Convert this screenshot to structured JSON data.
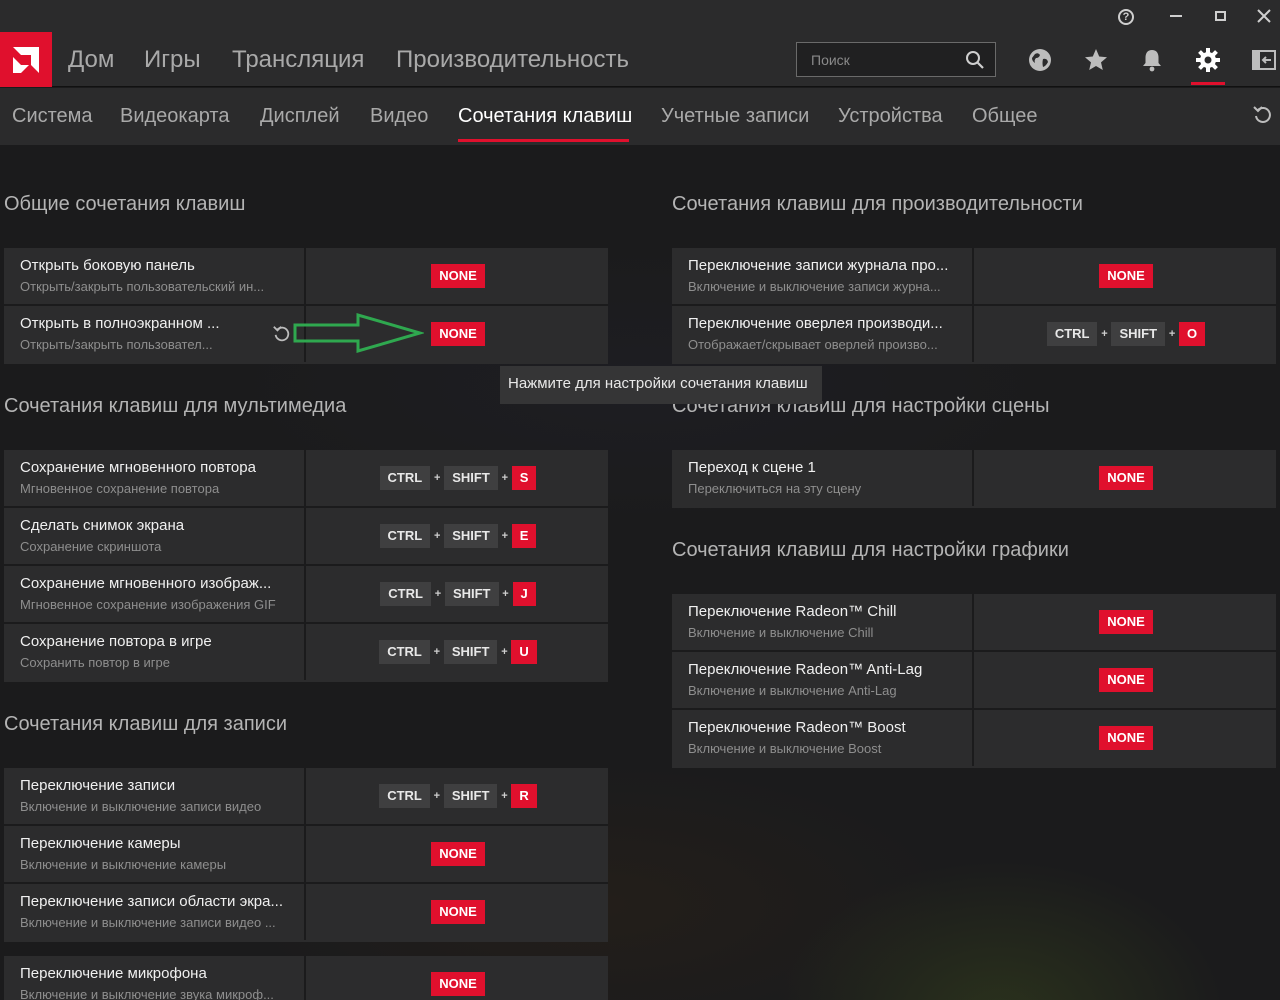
{
  "window": {
    "help": "?"
  },
  "nav": {
    "items": [
      "Дом",
      "Игры",
      "Трансляция",
      "Производительность"
    ],
    "search_placeholder": "Поиск"
  },
  "subnav": {
    "items": [
      "Система",
      "Видеокарта",
      "Дисплей",
      "Видео",
      "Сочетания клавиш",
      "Учетные записи",
      "Устройства",
      "Общее"
    ],
    "active": "Сочетания клавиш"
  },
  "tooltip": "Нажмите для настройки сочетания клавиш",
  "sections": {
    "general": {
      "title": "Общие сочетания клавиш",
      "rows": [
        {
          "name": "Открыть боковую панель",
          "desc": "Открыть/закрыть пользовательский ин...",
          "keys": [
            "NONE"
          ]
        },
        {
          "name": "Открыть в полноэкранном ...",
          "desc": "Открыть/закрыть пользовател...",
          "keys": [
            "NONE"
          ]
        }
      ]
    },
    "media": {
      "title": "Сочетания клавиш для мультимедиа",
      "rows": [
        {
          "name": "Сохранение мгновенного повтора",
          "desc": "Мгновенное сохранение повтора",
          "keys": [
            "CTRL",
            "SHIFT",
            "S"
          ]
        },
        {
          "name": "Сделать снимок экрана",
          "desc": "Сохранение скриншота",
          "keys": [
            "CTRL",
            "SHIFT",
            "E"
          ]
        },
        {
          "name": "Сохранение мгновенного изображ...",
          "desc": "Мгновенное сохранение изображения GIF",
          "keys": [
            "CTRL",
            "SHIFT",
            "J"
          ]
        },
        {
          "name": "Сохранение повтора в игре",
          "desc": "Сохранить повтор в игре",
          "keys": [
            "CTRL",
            "SHIFT",
            "U"
          ]
        }
      ]
    },
    "record": {
      "title": "Сочетания клавиш для записи",
      "rows": [
        {
          "name": "Переключение записи",
          "desc": "Включение и выключение записи видео",
          "keys": [
            "CTRL",
            "SHIFT",
            "R"
          ]
        },
        {
          "name": "Переключение камеры",
          "desc": "Включение и выключение камеры",
          "keys": [
            "NONE"
          ]
        },
        {
          "name": "Переключение записи области экра...",
          "desc": "Включение и выключение записи видео ...",
          "keys": [
            "NONE"
          ]
        }
      ]
    },
    "mic": {
      "rows": [
        {
          "name": "Переключение микрофона",
          "desc": "Включение и выключение звука микроф...",
          "keys": [
            "NONE"
          ]
        }
      ]
    },
    "performance": {
      "title": "Сочетания клавиш для производительности",
      "rows": [
        {
          "name": "Переключение записи журнала про...",
          "desc": "Включение и выключение записи журна...",
          "keys": [
            "NONE"
          ]
        },
        {
          "name": "Переключение оверлея производи...",
          "desc": "Отображает/скрывает оверлей произво...",
          "keys": [
            "CTRL",
            "SHIFT",
            "O"
          ]
        }
      ]
    },
    "scene": {
      "title": "Сочетания клавиш для настройки сцены",
      "rows": [
        {
          "name": "Переход к сцене 1",
          "desc": "Переключиться на эту сцену",
          "keys": [
            "NONE"
          ]
        }
      ]
    },
    "graphics": {
      "title": "Сочетания клавиш для настройки графики",
      "rows": [
        {
          "name": "Переключение Radeon™ Chill",
          "desc": "Включение и выключение Chill",
          "keys": [
            "NONE"
          ]
        },
        {
          "name": "Переключение Radeon™ Anti-Lag",
          "desc": "Включение и выключение Anti-Lag",
          "keys": [
            "NONE"
          ]
        },
        {
          "name": "Переключение Radeon™ Boost",
          "desc": "Включение и выключение Boost",
          "keys": [
            "NONE"
          ]
        }
      ]
    }
  },
  "colors": {
    "accent": "#e0102d",
    "arrow": "#2fa84f"
  }
}
